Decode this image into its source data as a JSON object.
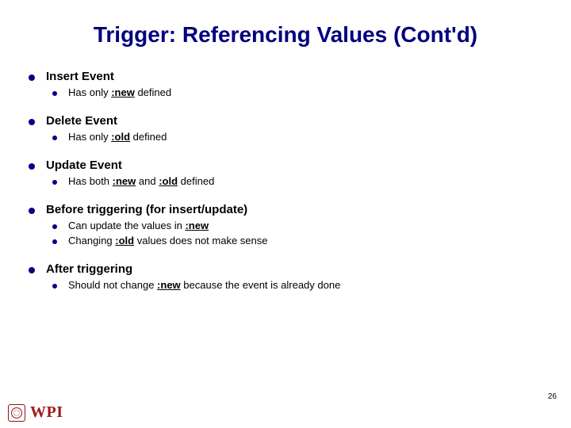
{
  "title": "Trigger: Referencing Values (Cont'd)",
  "sections": [
    {
      "heading": "Insert Event",
      "subs": [
        {
          "pre": "Has only ",
          "b1": ":new",
          "mid": " defined",
          "b2": "",
          "post": ""
        }
      ]
    },
    {
      "heading": "Delete Event",
      "subs": [
        {
          "pre": "Has only ",
          "b1": ":old",
          "mid": " defined",
          "b2": "",
          "post": ""
        }
      ]
    },
    {
      "heading": "Update Event",
      "subs": [
        {
          "pre": "Has both ",
          "b1": ":new",
          "mid": " and ",
          "b2": ":old",
          "post": " defined"
        }
      ]
    },
    {
      "heading": "Before triggering (for insert/update)",
      "subs": [
        {
          "pre": "Can update the values in ",
          "b1": ":new",
          "mid": "",
          "b2": "",
          "post": ""
        },
        {
          "pre": "Changing ",
          "b1": ":old",
          "mid": " values does not make sense",
          "b2": "",
          "post": ""
        }
      ]
    },
    {
      "heading": "After triggering",
      "subs": [
        {
          "pre": "Should not change ",
          "b1": ":new",
          "mid": " because the event is already done",
          "b2": "",
          "post": ""
        }
      ]
    }
  ],
  "pagenum": "26",
  "logo_text": "WPI"
}
